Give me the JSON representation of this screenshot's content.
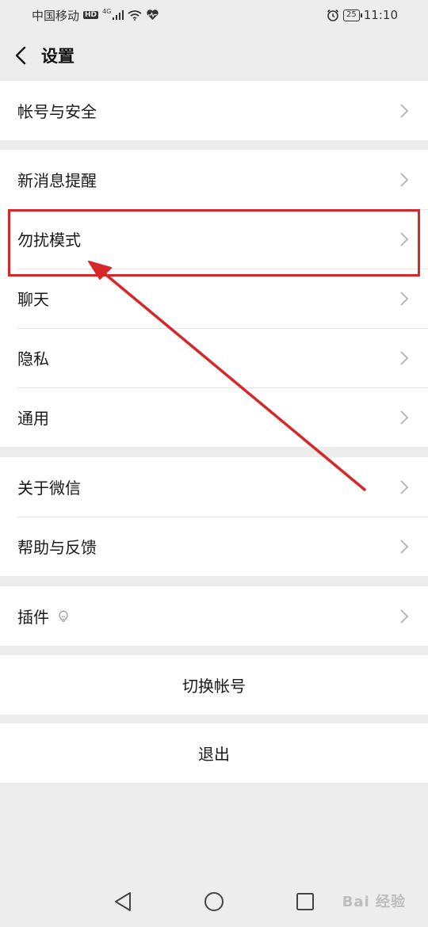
{
  "status_bar": {
    "carrier": "中国移动",
    "hd": "HD",
    "network": "4G",
    "battery": "25",
    "time": "11:10"
  },
  "nav": {
    "title": "设置"
  },
  "groups": {
    "account": {
      "label": "帐号与安全"
    },
    "notifications": {
      "label": "新消息提醒"
    },
    "dnd": {
      "label": "勿扰模式"
    },
    "chat": {
      "label": "聊天"
    },
    "privacy": {
      "label": "隐私"
    },
    "general": {
      "label": "通用"
    },
    "about": {
      "label": "关于微信"
    },
    "help": {
      "label": "帮助与反馈"
    },
    "plugins": {
      "label": "插件"
    },
    "switch_account": {
      "label": "切换帐号"
    },
    "logout": {
      "label": "退出"
    }
  },
  "annotation": {
    "color": "#d6282a"
  },
  "watermark": "Bai 经验"
}
